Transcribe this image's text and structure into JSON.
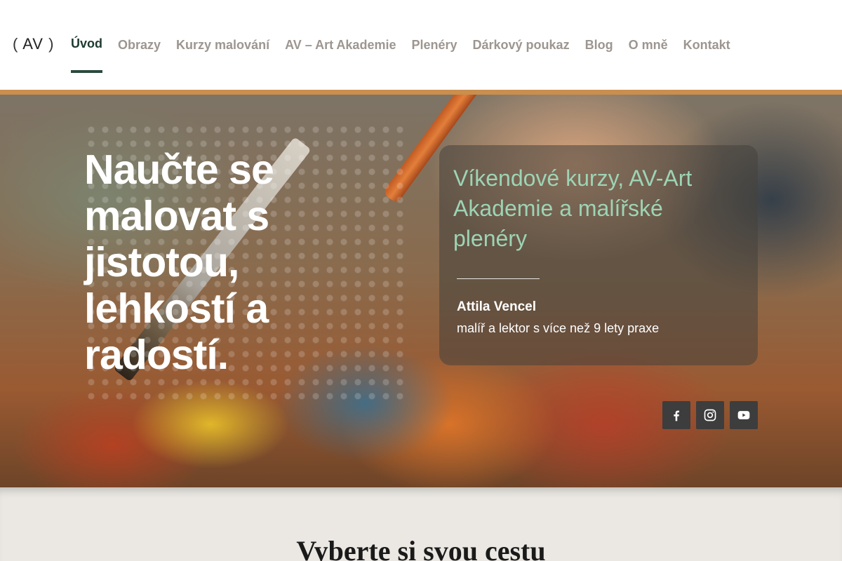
{
  "header": {
    "logo_left_paren": "(",
    "logo_text": "AV",
    "logo_right_paren": ")",
    "nav": [
      {
        "label": "Úvod",
        "active": true
      },
      {
        "label": "Obrazy"
      },
      {
        "label": "Kurzy malování"
      },
      {
        "label": "AV – Art Akademie"
      },
      {
        "label": "Plenéry"
      },
      {
        "label": "Dárkový poukaz"
      },
      {
        "label": "Blog"
      },
      {
        "label": "O mně"
      },
      {
        "label": "Kontakt"
      }
    ],
    "active_color": "#1e3a30",
    "inactive_color": "#9d9690",
    "stripe_color": "#c98f4e"
  },
  "hero": {
    "heading": "Naučte se malovat s jistotou, lehkostí a radostí.",
    "card": {
      "title": "Víkendové kurzy, AV-Art Akademie a malířské plenéry",
      "name": "Attila Vencel",
      "role": "malíř a lektor s více než 9 lety praxe",
      "title_color": "#9dd4b5"
    },
    "social": [
      {
        "icon": "facebook-icon"
      },
      {
        "icon": "instagram-icon"
      },
      {
        "icon": "youtube-icon"
      }
    ]
  },
  "section": {
    "title": "Vyberte si svou cestu"
  }
}
